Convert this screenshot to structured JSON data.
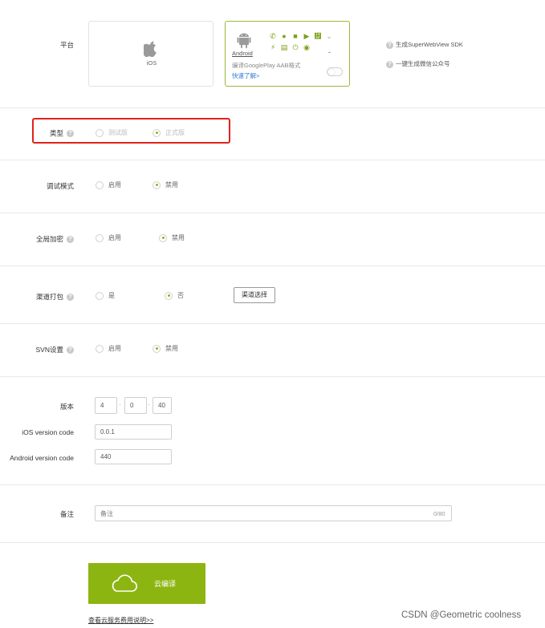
{
  "platform": {
    "label": "平台",
    "ios_label": "iOS",
    "android_label": "Android",
    "android_aab_note": "编译GooglePlay AAB格式",
    "android_learn_more": "快速了解>",
    "android_dash": "-",
    "side_options": [
      "生成SuperWebView SDK",
      "一键生成微信公众号"
    ]
  },
  "type": {
    "label": "类型",
    "options": [
      "测试版",
      "正式版"
    ],
    "selected": 1
  },
  "debug": {
    "label": "调试模式",
    "options": [
      "启用",
      "禁用"
    ],
    "selected": 1
  },
  "encrypt": {
    "label": "全局加密",
    "options": [
      "启用",
      "禁用"
    ],
    "selected": 1
  },
  "channel": {
    "label": "渠道打包",
    "options": [
      "是",
      "否"
    ],
    "selected": 1,
    "select_button": "渠道选择"
  },
  "svn": {
    "label": "SVN设置",
    "options": [
      "启用",
      "禁用"
    ],
    "selected": 1
  },
  "version": {
    "label": "版本",
    "major": "4",
    "minor": "0",
    "patch": "40",
    "sep": "·",
    "ios_code_label": "iOS version code",
    "ios_code_value": "0.0.1",
    "android_code_label": "Android version code",
    "android_code_value": "440"
  },
  "remark": {
    "label": "备注",
    "placeholder": "备注",
    "counter": "0/80"
  },
  "compile_button": "云编译",
  "fee_link": "查看云服务费用说明>>",
  "watermark": "CSDN @Geometric coolness",
  "colors": {
    "accent": "#8db512",
    "highlight_box": "#e0221b",
    "selected_border": "#9ab93a"
  }
}
